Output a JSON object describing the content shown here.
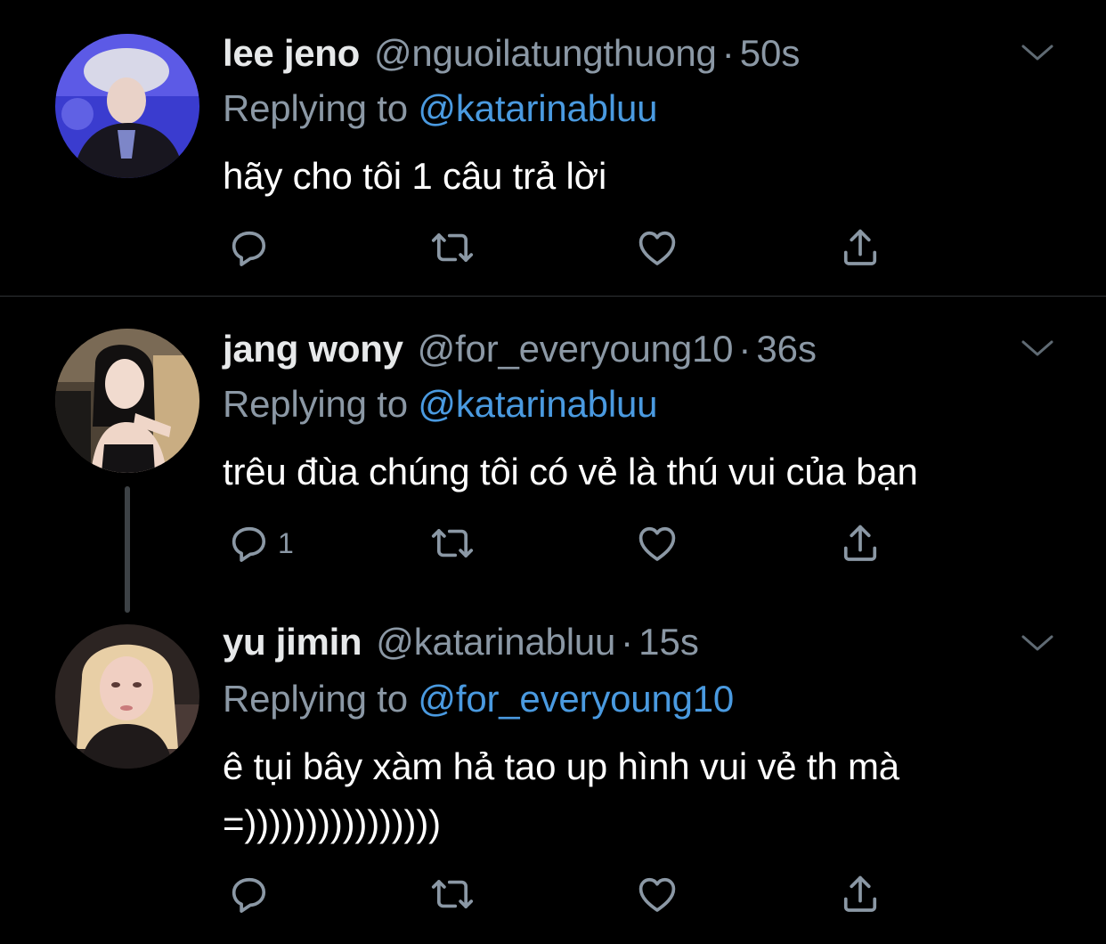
{
  "colors": {
    "background": "#000000",
    "secondary_text": "#8b98a5",
    "link": "#4a9ae0",
    "divider": "#2f3336",
    "icon": "#8b98a5"
  },
  "tweets": [
    {
      "name": "lee jeno",
      "handle": "@nguoilatungthuong",
      "dot": "·",
      "time": "50s",
      "replying_prefix": "Replying to",
      "replying_to": "@katarinabluu",
      "text": "hãy cho tôi 1 câu trả lời",
      "reply_count": "",
      "icons": [
        "reply-icon",
        "retweet-icon",
        "like-icon",
        "share-icon",
        "chevron-down-icon"
      ]
    },
    {
      "name": "jang wony",
      "handle": "@for_everyoung10",
      "dot": "·",
      "time": "36s",
      "replying_prefix": "Replying to",
      "replying_to": "@katarinabluu",
      "text": "trêu đùa chúng tôi có vẻ là thú vui của bạn",
      "reply_count": "1",
      "icons": [
        "reply-icon",
        "retweet-icon",
        "like-icon",
        "share-icon",
        "chevron-down-icon"
      ]
    },
    {
      "name": "yu jimin",
      "handle": "@katarinabluu",
      "dot": "·",
      "time": "15s",
      "replying_prefix": "Replying to",
      "replying_to": "@for_everyoung10",
      "text": "ê tụi bây xàm hả tao up hình vui vẻ th mà\n=))))))))))))))))",
      "reply_count": "",
      "icons": [
        "reply-icon",
        "retweet-icon",
        "like-icon",
        "share-icon",
        "chevron-down-icon"
      ]
    }
  ]
}
